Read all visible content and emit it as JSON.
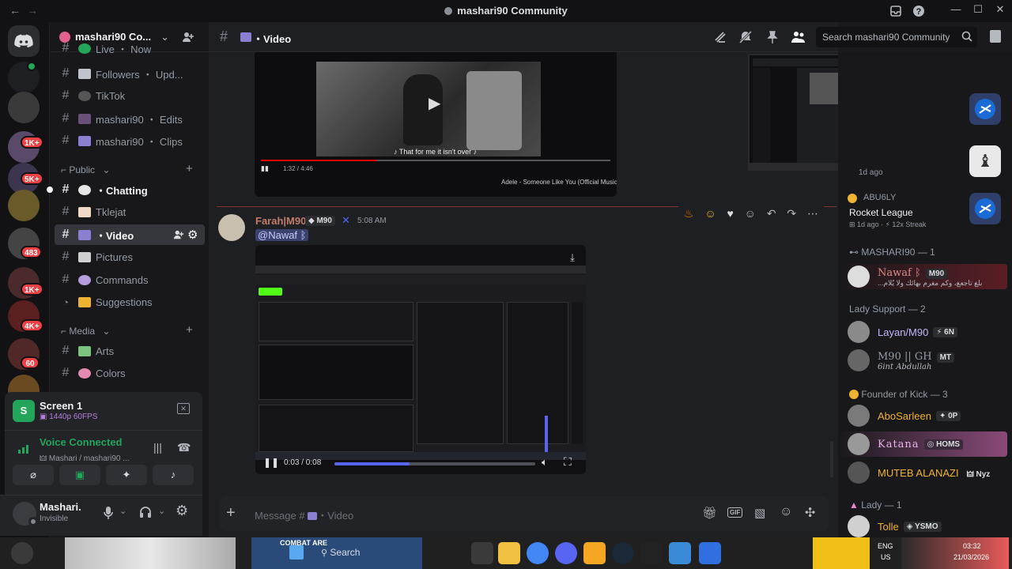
{
  "titlebar": {
    "title": "mashari90 Community",
    "back_glyph": "←",
    "forward_glyph": "→"
  },
  "rail": {
    "badges": [
      "1K+",
      "5K+",
      "483",
      "1K+",
      "4K+",
      "60"
    ]
  },
  "server": {
    "name": "mashari90 Co...",
    "channels_top": [
      {
        "label": "Live ・ Now"
      },
      {
        "label": "Followers ・ Upd..."
      },
      {
        "label": "TikTok"
      },
      {
        "label": "mashari90 ・ Edits"
      },
      {
        "label": "mashari90 ・ Clips"
      }
    ],
    "category_public": "Public",
    "channels_public": [
      {
        "label": "・Chatting"
      },
      {
        "label": "Tklejat"
      },
      {
        "label": "・Video"
      },
      {
        "label": "Pictures"
      },
      {
        "label": "Commands"
      },
      {
        "label": "Suggestions"
      }
    ],
    "category_media": "Media",
    "channels_media": [
      {
        "label": "Arts"
      },
      {
        "label": "Colors"
      }
    ]
  },
  "voice": {
    "screen_title": "Screen 1",
    "screen_quality": "1440p 60FPS",
    "connected": "Voice Connected",
    "location": "Mashari / mashari90 ...",
    "user_name": "Mashari.",
    "user_status": "Invisible"
  },
  "channel": {
    "name": "・Video",
    "search_placeholder": "Search mashari90 Community",
    "composer_placeholder": "Message #",
    "composer_channel": "・Video"
  },
  "embed1": {
    "lyric": "♪ That for me it isn't over ♪",
    "yt_title": "Adele - Someone Like You (Official Music Video)",
    "yt_time": "1:32 / 4:46"
  },
  "message": {
    "author": "Farah|M90",
    "author_tag": "M90",
    "time": "5:08 AM",
    "mention": "@Nawaf ᛒ",
    "video_time": "0:03 / 0:08",
    "video_progress": 0.375
  },
  "members": {
    "activity_ago": "1d ago",
    "activity_user": "ABU6LY",
    "activity_game": "Rocket League",
    "activity_streak": "12x Streak",
    "roles": [
      {
        "name": "MASHARI90 — 1"
      },
      {
        "name": "Lady Support — 2"
      },
      {
        "name": "Founder of Kick — 3"
      },
      {
        "name": "Lady — 1"
      }
    ],
    "list": [
      {
        "name": "Nawaf ᛒ",
        "tag": "M90",
        "sub": "...بلغ تاجعغ، وكم مغرم بهائك ولا يُلام"
      },
      {
        "name": "Layan/M90",
        "tag": "6N"
      },
      {
        "name": "M90 || GH",
        "tag": "MT",
        "sub": "6int Abdullah"
      },
      {
        "name": "AboSarleen",
        "tag": "0P"
      },
      {
        "name": "Katana",
        "tag": "HOMS"
      },
      {
        "name": "MUTEB ALANAZI",
        "tag": "Nyz"
      },
      {
        "name": "Tolle",
        "tag": "YSMO"
      }
    ]
  },
  "taskbar": {
    "search": "Search",
    "lang": "ENG",
    "region": "US",
    "time": "03:32",
    "date": "21/03/2026",
    "combat_label": "COMBAT ARE"
  },
  "colors": {
    "brand": "#5865f2",
    "accent_green": "#23a55a",
    "danger": "#f23f43",
    "author": "#c27c6b"
  },
  "icons": [
    "discord-icon",
    "pin-icon",
    "members-icon",
    "threads-icon",
    "search-icon",
    "gift-icon",
    "gif-icon",
    "emoji-icon",
    "mic-icon",
    "headphones-icon",
    "gear-icon"
  ]
}
